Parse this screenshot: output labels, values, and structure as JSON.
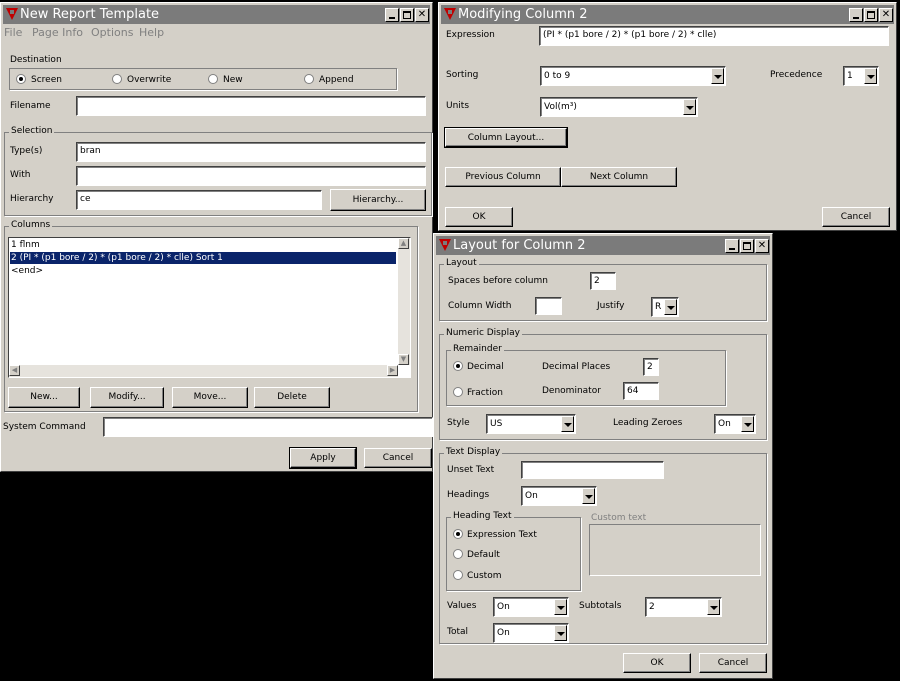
{
  "report_window": {
    "title": "New Report Template",
    "menu": [
      "File",
      "Page Info",
      "Options",
      "Help"
    ],
    "destination": {
      "label": "Destination",
      "options": [
        "Screen",
        "Overwrite",
        "New",
        "Append"
      ],
      "selected": "Screen",
      "filename_label": "Filename",
      "filename_value": ""
    },
    "selection": {
      "label": "Selection",
      "types_label": "Type(s)",
      "types_value": "bran",
      "with_label": "With",
      "with_value": "",
      "hierarchy_label": "Hierarchy",
      "hierarchy_value": "ce",
      "hierarchy_button": "Hierarchy..."
    },
    "columns": {
      "label": "Columns",
      "rows": [
        "1  flnm",
        "2  (PI * (p1 bore / 2) * (p1 bore / 2) * clle)   Sort 1",
        "<end>"
      ],
      "selected_index": 1,
      "buttons": [
        "New...",
        "Modify...",
        "Move...",
        "Delete"
      ]
    },
    "system_command_label": "System Command",
    "system_command_value": "",
    "apply": "Apply",
    "cancel": "Cancel"
  },
  "modify_window": {
    "title": "Modifying Column 2",
    "expression_label": "Expression",
    "expression_value": "(PI * (p1 bore / 2) * (p1 bore / 2) * clle)",
    "sorting_label": "Sorting",
    "sorting_value": "0 to 9",
    "precedence_label": "Precedence",
    "precedence_value": "1",
    "units_label": "Units",
    "units_value": "Vol(m³)",
    "column_layout_button": "Column Layout...",
    "prev_button": "Previous Column",
    "next_button": "Next Column",
    "ok": "OK",
    "cancel": "Cancel"
  },
  "layout_window": {
    "title": "Layout for Column 2",
    "layout": {
      "label": "Layout",
      "spaces_label": "Spaces before column",
      "spaces_value": "2",
      "width_label": "Column Width",
      "width_value": "",
      "justify_label": "Justify",
      "justify_value": "R"
    },
    "numeric": {
      "label": "Numeric Display",
      "remainder_label": "Remainder",
      "decimal_label": "Decimal",
      "fraction_label": "Fraction",
      "selected": "Decimal",
      "decimal_places_label": "Decimal Places",
      "decimal_places_value": "2",
      "denominator_label": "Denominator",
      "denominator_value": "64",
      "style_label": "Style",
      "style_value": "US",
      "leading_zeroes_label": "Leading Zeroes",
      "leading_zeroes_value": "On"
    },
    "text": {
      "label": "Text Display",
      "unset_label": "Unset Text",
      "unset_value": "",
      "headings_label": "Headings",
      "headings_value": "On",
      "heading_text_label": "Heading Text",
      "options": [
        "Expression Text",
        "Default",
        "Custom"
      ],
      "selected": "Expression Text",
      "custom_text_label": "Custom text",
      "values_label": "Values",
      "values_value": "On",
      "subtotals_label": "Subtotals",
      "subtotals_value": "2",
      "total_label": "Total",
      "total_value": "On"
    },
    "ok": "OK",
    "cancel": "Cancel"
  }
}
